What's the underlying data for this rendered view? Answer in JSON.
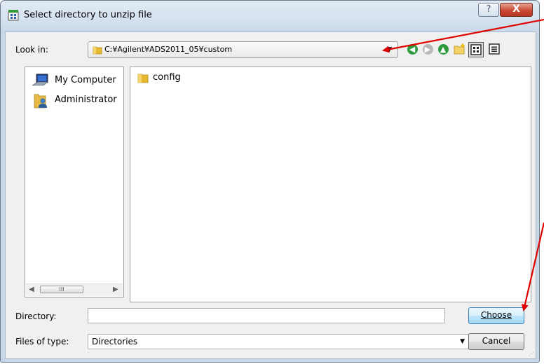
{
  "window": {
    "title": "Select directory to unzip file",
    "help_glyph": "?",
    "close_glyph": "X"
  },
  "lookin": {
    "label": "Look in:",
    "path": "C:¥Agilent¥ADS2011_05¥custom"
  },
  "toolbar": {
    "buttons": [
      {
        "name": "back-icon",
        "glyph": "◀"
      },
      {
        "name": "forward-icon",
        "glyph": "▶"
      },
      {
        "name": "up-folder-icon",
        "glyph": "▲"
      },
      {
        "name": "new-folder-icon",
        "glyph": ""
      },
      {
        "name": "list-view-icon",
        "glyph": ""
      },
      {
        "name": "details-view-icon",
        "glyph": ""
      }
    ]
  },
  "places": {
    "items": [
      {
        "label": "My Computer",
        "icon": "computer-icon"
      },
      {
        "label": "Administrator",
        "icon": "user-folder-icon"
      }
    ],
    "scroll_thumb": "III"
  },
  "files": {
    "items": [
      {
        "label": "config",
        "icon": "folder-icon"
      }
    ]
  },
  "directory": {
    "label": "Directory:",
    "value": ""
  },
  "filetype": {
    "label": "Files of type:",
    "value": "Directories"
  },
  "buttons": {
    "choose": "Choose",
    "cancel": "Cancel"
  },
  "colors": {
    "annotation_arrow": "#e00000",
    "choose_border": "#3c7fb1",
    "folder": "#e8b830"
  }
}
